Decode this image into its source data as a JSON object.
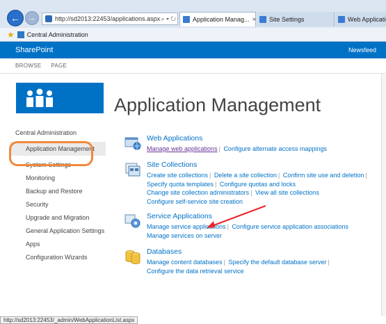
{
  "browser": {
    "address_url": "http://sd2013:22453/applications.aspx",
    "address_controls": "⌕ ▾ ↻",
    "tabs": [
      {
        "label": "Application Manag...",
        "active": true
      },
      {
        "label": "Site Settings",
        "active": false
      },
      {
        "label": "Web Applicatio",
        "active": false
      }
    ],
    "favorites_label": "Central Administration",
    "status_url": "http://sd2013:22453/_admin/WebApplicationList.aspx"
  },
  "suitebar": {
    "brand": "SharePoint",
    "newsfeed": "Newsfeed"
  },
  "ribbon": {
    "tabs": [
      "BROWSE",
      "PAGE"
    ]
  },
  "page_title": "Application Management",
  "leftnav": {
    "heading": "Central Administration",
    "items": [
      {
        "label": "Application Management",
        "selected": true
      },
      {
        "label": "System Settings"
      },
      {
        "label": "Monitoring"
      },
      {
        "label": "Backup and Restore"
      },
      {
        "label": "Security"
      },
      {
        "label": "Upgrade and Migration"
      },
      {
        "label": "General Application Settings"
      },
      {
        "label": "Apps"
      },
      {
        "label": "Configuration Wizards"
      }
    ]
  },
  "sections": {
    "web_apps": {
      "title": "Web Applications",
      "links": [
        "Manage web applications",
        "Configure alternate access mappings"
      ]
    },
    "site_collections": {
      "title": "Site Collections",
      "links": [
        "Create site collections",
        "Delete a site collection",
        "Confirm site use and deletion",
        "Specify quota templates",
        "Configure quotas and locks",
        "Change site collection administrators",
        "View all site collections",
        "Configure self-service site creation"
      ]
    },
    "service_apps": {
      "title": "Service Applications",
      "links": [
        "Manage service applications",
        "Configure service application associations",
        "Manage services on server"
      ]
    },
    "databases": {
      "title": "Databases",
      "links": [
        "Manage content databases",
        "Specify the default database server",
        "Configure the data retrieval service"
      ]
    }
  },
  "colors": {
    "accent": "#0072c6",
    "annotation": "#e8262b",
    "highlight_ring": "#f0893b"
  },
  "separator": "|"
}
